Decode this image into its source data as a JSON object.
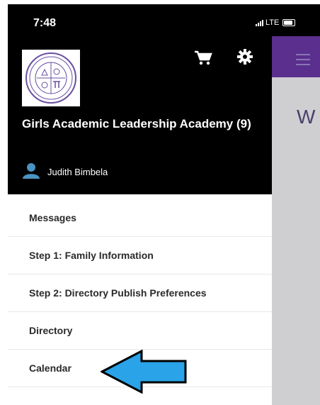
{
  "status_bar": {
    "time": "7:48",
    "network": "LTE"
  },
  "drawer": {
    "school_name": "Girls Academic Leadership Academy (9)",
    "user_name": "Judith Bimbela",
    "menu": [
      {
        "label": "Messages"
      },
      {
        "label": "Step 1: Family Information"
      },
      {
        "label": "Step 2: Directory Publish Preferences"
      },
      {
        "label": "Directory"
      },
      {
        "label": "Calendar"
      }
    ]
  },
  "background_app": {
    "greeting_partial": "W",
    "accent_color": "#5a2f8e"
  },
  "icons": [
    "cart-icon",
    "gear-icon",
    "user-icon",
    "hamburger-icon",
    "arrow-pointer"
  ],
  "colors": {
    "drawer_header": "#000000",
    "arrow_fill": "#2aa3e8"
  }
}
